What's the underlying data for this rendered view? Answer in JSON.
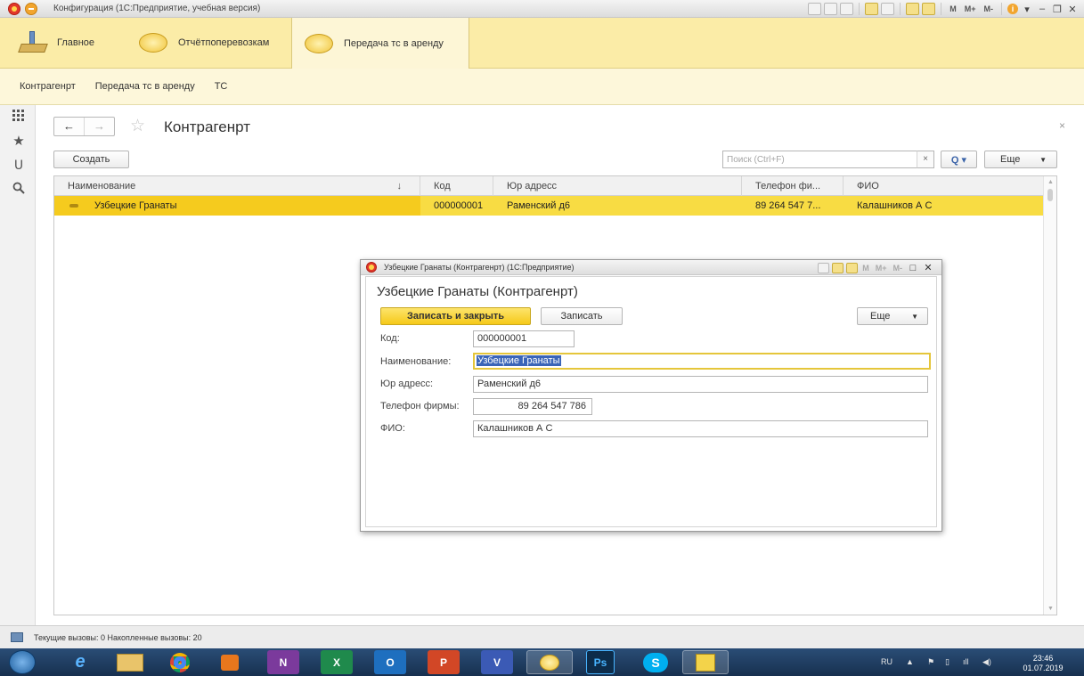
{
  "window": {
    "title": "Конфигурация  (1С:Предприятие, учебная версия)",
    "memory_buttons": [
      "M",
      "M+",
      "M-"
    ]
  },
  "sections": [
    {
      "label": "Главное"
    },
    {
      "label": "Отчётпоперевозкам"
    },
    {
      "label": "Передача тс в аренду"
    }
  ],
  "subnav": [
    "Контрагенрт",
    "Передача тс в аренду",
    "ТС"
  ],
  "page": {
    "title": "Контрагенрт",
    "create_label": "Создать",
    "search_placeholder": "Поиск (Ctrl+F)",
    "search_clear": "×",
    "search_button": "Q ▾",
    "more_label": "Еще",
    "close_glyph": "×"
  },
  "table": {
    "columns": [
      "Наименование",
      "Код",
      "Юр адресс",
      "Телефон фи...",
      "ФИО"
    ],
    "sort_indicator": "↓",
    "rows": [
      {
        "name": "Узбецкие Гранаты",
        "code": "000000001",
        "address": "Раменский д6",
        "phone": "89 264 547 7...",
        "fio": "Калашников А С"
      }
    ]
  },
  "dialog": {
    "window_title": "Узбецкие Гранаты (Контрагенрт)  (1С:Предприятие)",
    "heading": "Узбецкие Гранаты (Контрагенрт)",
    "save_close_label": "Записать и закрыть",
    "save_label": "Записать",
    "more_label": "Еще",
    "fields": {
      "code": {
        "label": "Код:",
        "value": "000000001"
      },
      "name": {
        "label": "Наименование:",
        "value": "Узбецкие Гранаты"
      },
      "address": {
        "label": "Юр адресс:",
        "value": "Раменский д6"
      },
      "phone": {
        "label": "Телефон фирмы:",
        "value": "89 264 547 786"
      },
      "fio": {
        "label": "ФИО:",
        "value": "Калашников А С"
      }
    }
  },
  "statusbar": {
    "text": "Текущие вызовы: 0   Накопленные вызовы: 20"
  },
  "taskbar": {
    "apps": [
      "e",
      "N",
      "X",
      "O",
      "P",
      "V",
      "Ps",
      "S"
    ],
    "language": "RU",
    "time": "23:46",
    "date": "01.07.2019"
  },
  "colors": {
    "section_panel": "#fbeca7",
    "selected_row": "#f8dc43",
    "primary_button": "#f5c919",
    "taskbar": "#1f3d63"
  }
}
